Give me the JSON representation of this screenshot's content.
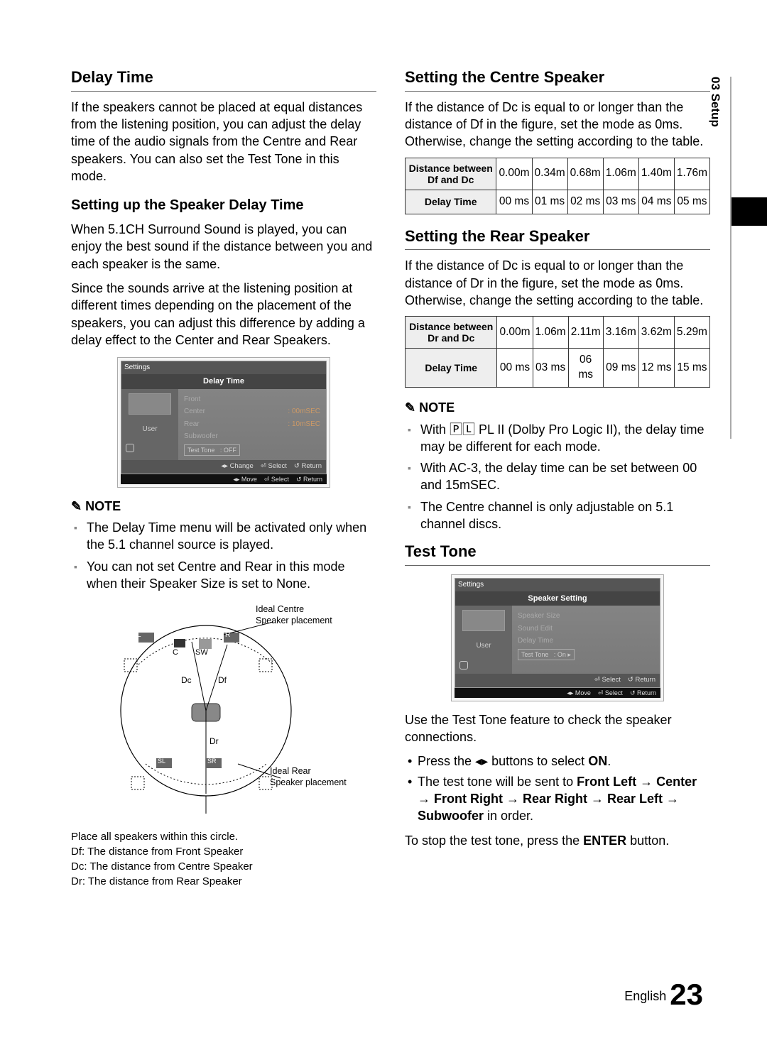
{
  "sideTab": "03  Setup",
  "left": {
    "h_delay": "Delay Time",
    "p_delay": "If the speakers cannot be placed at equal distances from the listening position, you can adjust the delay time of the audio signals from the Centre and  Rear speakers. You can also set the Test Tone in this mode.",
    "h_setup": "Setting up the Speaker Delay Time",
    "p_setup1": "When 5.1CH Surround Sound is played, you can enjoy the best sound if the distance between you and each speaker is the same.",
    "p_setup2": "Since the sounds arrive at the listening position at different times depending on the placement of the speakers, you can adjust this difference by adding a delay effect to the Center and Rear Speakers.",
    "osd1": {
      "top": "Settings",
      "title": "Delay Time",
      "user": "User",
      "rows": [
        {
          "label": "Front",
          "value": ""
        },
        {
          "label": "Center",
          "value": ":  00mSEC"
        },
        {
          "label": "Rear",
          "value": ":  10mSEC"
        },
        {
          "label": "Subwoofer",
          "value": ""
        }
      ],
      "box_label": "Test Tone",
      "box_value": ":  OFF",
      "foot": [
        "◂▸ Change",
        "⏎ Select",
        "↺ Return"
      ],
      "strip": [
        "◂▸ Move",
        "⏎ Select",
        "↺ Return"
      ]
    },
    "note_label": "NOTE",
    "notes": [
      "The Delay Time menu will be activated only when the 5.1 channel source is played.",
      "You can not set Centre and Rear in this mode when their Speaker Size is set to None."
    ],
    "diag": {
      "ideal_centre": "Ideal Centre",
      "speaker_placement": "Speaker placement",
      "ideal_rear": "Ideal Rear",
      "L": "L",
      "R": "R",
      "C": "C",
      "SW": "SW",
      "Dc": "Dc",
      "Df": "Df",
      "Dr": "Dr",
      "SL": "SL",
      "SR": "SR"
    },
    "legend_top": "Place all speakers within this circle.",
    "legend_lines": [
      "Df: The distance from Front Speaker",
      "Dc: The distance from Centre Speaker",
      "Dr: The distance from Rear Speaker"
    ]
  },
  "right": {
    "h_centre": "Setting the Centre Speaker",
    "p_centre": "If the distance of Dc is equal to or longer than the distance of Df in the figure, set the mode as 0ms. Otherwise, change the setting according to the table.",
    "t_centre": {
      "row1_head": "Distance between Df and Dc",
      "row1": [
        "0.00m",
        "0.34m",
        "0.68m",
        "1.06m",
        "1.40m",
        "1.76m"
      ],
      "row2_head": "Delay Time",
      "row2": [
        "00 ms",
        "01 ms",
        "02 ms",
        "03 ms",
        "04 ms",
        "05 ms"
      ]
    },
    "h_rear": "Setting the Rear Speaker",
    "p_rear": "If the distance of Dc is equal to or longer than the distance of Dr in the figure, set the mode as 0ms. Otherwise, change the setting according to the table.",
    "t_rear": {
      "row1_head": "Distance between Dr and Dc",
      "row1": [
        "0.00m",
        "1.06m",
        "2.11m",
        "3.16m",
        "3.62m",
        "5.29m"
      ],
      "row2_head": "Delay Time",
      "row2": [
        "00 ms",
        "03 ms",
        "06 ms",
        "09 ms",
        "12 ms",
        "15 ms"
      ]
    },
    "note_label": "NOTE",
    "notes": [
      "With 🄿🄻 PL II (Dolby Pro Logic II), the delay time may be different for each mode.",
      "With AC-3, the delay time can be set between 00 and 15mSEC.",
      "The Centre channel is only adjustable on 5.1 channel discs."
    ],
    "h_test": "Test Tone",
    "osd2": {
      "top": "Settings",
      "title": "Speaker Setting",
      "user": "User",
      "rows": [
        {
          "label": "Speaker Size",
          "value": ""
        },
        {
          "label": "Sound Edit",
          "value": ""
        },
        {
          "label": "Delay Time",
          "value": ""
        }
      ],
      "box_label": "Test Tone",
      "box_value": ":  On   ▸",
      "foot": [
        "⏎ Select",
        "↺ Return"
      ],
      "strip": [
        "◂▸ Move",
        "⏎ Select",
        "↺ Return"
      ]
    },
    "p_test": "Use the Test Tone feature to check the speaker connections.",
    "bullets": [
      {
        "pre": "Press the ◂▸ buttons to select ",
        "bold": "ON",
        "post": "."
      },
      {
        "pre": "The test tone will be sent to ",
        "bold": "Front Left → Center → Front Right → Rear Right → Rear Left → Subwoofer",
        "post": " in order."
      }
    ],
    "p_stop_pre": "To stop the test tone, press the ",
    "p_stop_bold": "ENTER",
    "p_stop_post": " button."
  },
  "footer": {
    "lang": "English",
    "num": "23"
  }
}
